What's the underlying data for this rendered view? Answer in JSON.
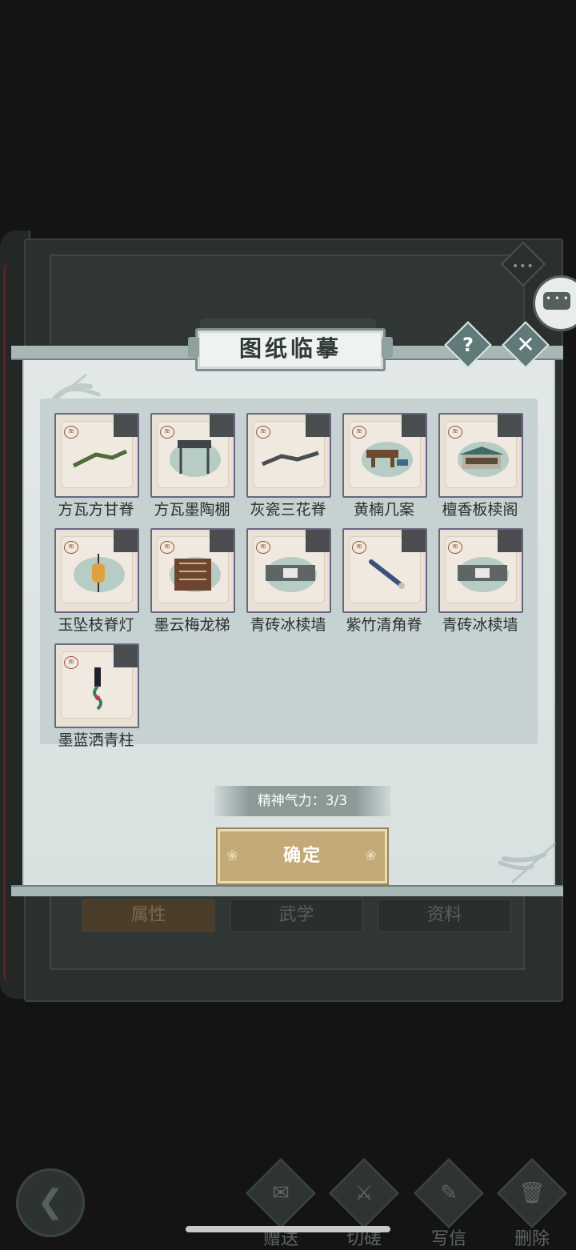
{
  "dialog": {
    "title": "图纸临摹",
    "help_icon": "?",
    "close_icon": "✕"
  },
  "blueprints": [
    {
      "label": "方瓦方甘脊"
    },
    {
      "label": "方瓦墨陶棚"
    },
    {
      "label": "灰瓷三花脊"
    },
    {
      "label": "黄楠几案"
    },
    {
      "label": "檀香板椟阁"
    },
    {
      "label": "玉坠枝脊灯"
    },
    {
      "label": "墨云梅龙梯"
    },
    {
      "label": "青砖冰椟墙"
    },
    {
      "label": "紫竹清角脊"
    },
    {
      "label": "青砖冰椟墙"
    },
    {
      "label": "墨蓝洒青柱"
    }
  ],
  "energy": {
    "label": "精神气力：3/3",
    "current": 3,
    "max": 3
  },
  "confirm_label": "确定",
  "background": {
    "tabs": [
      "属性",
      "武学",
      "资料"
    ],
    "more_icon": "•••"
  },
  "bottom_nav": {
    "back_icon": "❮",
    "items": [
      {
        "label": "赠送",
        "icon": "scroll-icon"
      },
      {
        "label": "切磋",
        "icon": "sword-icon"
      },
      {
        "label": "写信",
        "icon": "letter-icon"
      },
      {
        "label": "删除",
        "icon": "trash-icon"
      }
    ]
  },
  "colors": {
    "backdrop": "#141414",
    "modal_bg": "#e2e9e8",
    "grid_bg": "#c6d2d1",
    "card_border": "#6c6584",
    "confirm_btn": "#c3aa78",
    "accent_teal": "#5f7a78"
  }
}
